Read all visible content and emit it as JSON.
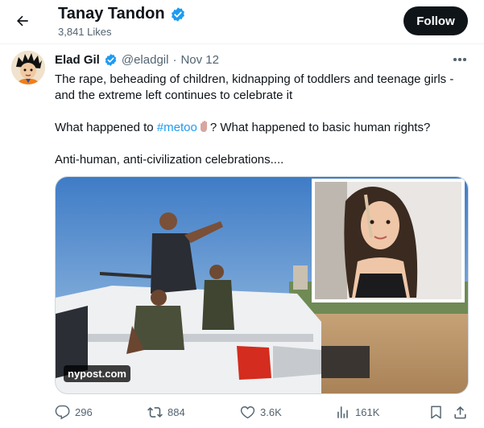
{
  "header": {
    "profile_name": "Tanay Tandon",
    "likes_count": "3,841 Likes",
    "follow_label": "Follow"
  },
  "tweet": {
    "author_name": "Elad Gil",
    "author_handle": "@eladgil",
    "separator": "·",
    "time": "Nov 12",
    "line1": "The rape, beheading of children, kidnapping of toddlers and teenage girls - and the extreme left continues to celebrate it",
    "line2_before": "What happened to ",
    "line2_hashtag": "#metoo",
    "line2_after": "? What happened to basic human rights?",
    "line3": "Anti-human, anti-civilization celebrations....",
    "media_source": "nypost.com"
  },
  "actions": {
    "replies": "296",
    "reposts": "884",
    "likes": "3.6K",
    "views": "161K"
  },
  "colors": {
    "accent": "#1d9bf0",
    "text": "#0f1419",
    "secondary": "#536471"
  },
  "icons": [
    "back-arrow-icon",
    "verified-badge-icon",
    "more-icon",
    "reply-icon",
    "repost-icon",
    "like-icon",
    "views-icon",
    "bookmark-icon",
    "share-icon",
    "raised-hand-emoji"
  ]
}
